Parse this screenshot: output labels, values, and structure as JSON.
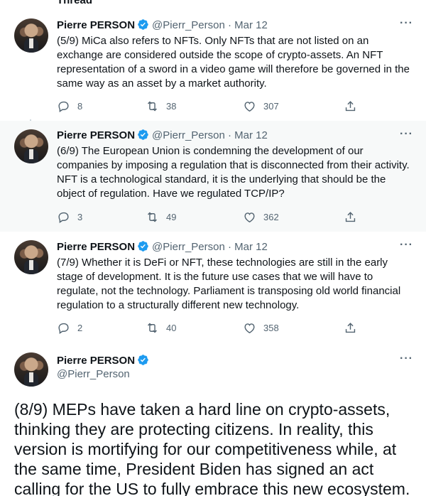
{
  "thread_header": "Thread",
  "tweets": [
    {
      "name": "Pierre PERSON",
      "handle": "@Pierr_Person",
      "separator": "·",
      "date": "Mar 12",
      "text": "(5/9) MiCa also refers to NFTs. Only NFTs that are not listed on an exchange are considered outside the scope of crypto-assets. An NFT representation of a sword in a video game will therefore be governed in the same way as an asset by a market authority.",
      "replies": "8",
      "retweets": "38",
      "likes": "307"
    },
    {
      "name": "Pierre PERSON",
      "handle": "@Pierr_Person",
      "separator": "·",
      "date": "Mar 12",
      "text": "(6/9) The European Union is condemning the development of our companies by imposing a regulation that is disconnected from their activity. NFT is a technological standard, it is the underlying that should be the object of regulation. Have we regulated TCP/IP?",
      "replies": "3",
      "retweets": "49",
      "likes": "362"
    },
    {
      "name": "Pierre PERSON",
      "handle": "@Pierr_Person",
      "separator": "·",
      "date": "Mar 12",
      "text": "(7/9) Whether it is DeFi or NFT, these technologies are still in the early stage of development. It is the future use cases that we will have to regulate, not the technology.  Parliament is transposing old world financial regulation to a structurally different new technology.",
      "replies": "2",
      "retweets": "40",
      "likes": "358"
    }
  ],
  "main_tweet": {
    "name": "Pierre PERSON",
    "handle": "@Pierr_Person",
    "text": "(8/9) MEPs have taken a hard line on crypto-assets, thinking they are protecting citizens. In reality, this version is mortifying for our competitiveness while, at the same time, President Biden has signed an act calling for the US to fully embrace this new ecosystem."
  },
  "more_label": "···",
  "colors": {
    "verified": "#1d9bf0",
    "muted": "#536471",
    "thread_line": "#cfd9de",
    "highlight_bg": "#f7f9f9"
  }
}
